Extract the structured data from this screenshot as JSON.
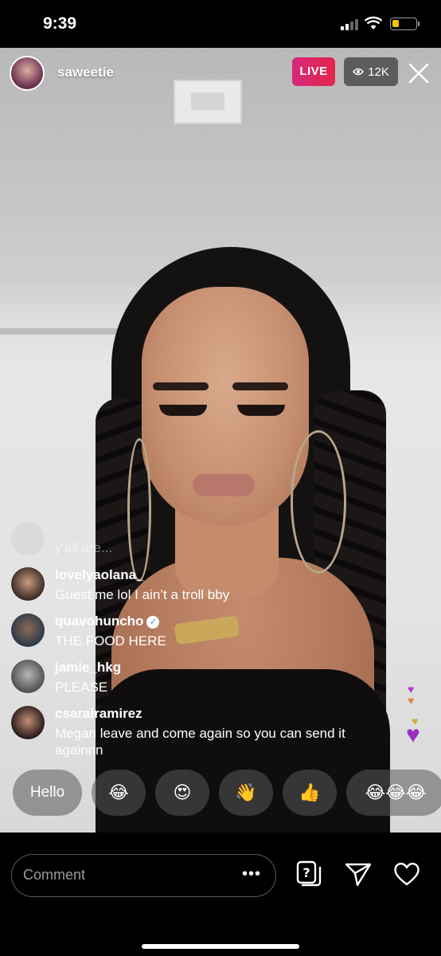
{
  "status_bar": {
    "time": "9:39"
  },
  "live_header": {
    "username": "saweetie",
    "live_label": "LIVE",
    "viewer_count": "12K"
  },
  "comments": [
    {
      "username": "...",
      "text": "y'all are..."
    },
    {
      "username": "lovelyaolana_",
      "text": "Guest me lol I ain’t a troll bby"
    },
    {
      "username": "quavohuncho",
      "verified": true,
      "text": "THE FOOD HERE"
    },
    {
      "username": "jamie_hkg",
      "text": "PLEASE"
    },
    {
      "username": "csarairamirez",
      "text": "Megan leave and come again so you can send it againnn"
    }
  ],
  "quick_replies": [
    "Hello",
    "😂",
    "😍",
    "👋",
    "👍",
    "😂😂😂"
  ],
  "bottom_bar": {
    "comment_placeholder": "Comment",
    "more_label": "•••"
  },
  "colors": {
    "live_badge": "#e3264d",
    "verified": "#3897f0"
  },
  "icons": [
    "question-box-icon",
    "send-icon",
    "heart-icon",
    "close-icon",
    "eye-icon"
  ]
}
